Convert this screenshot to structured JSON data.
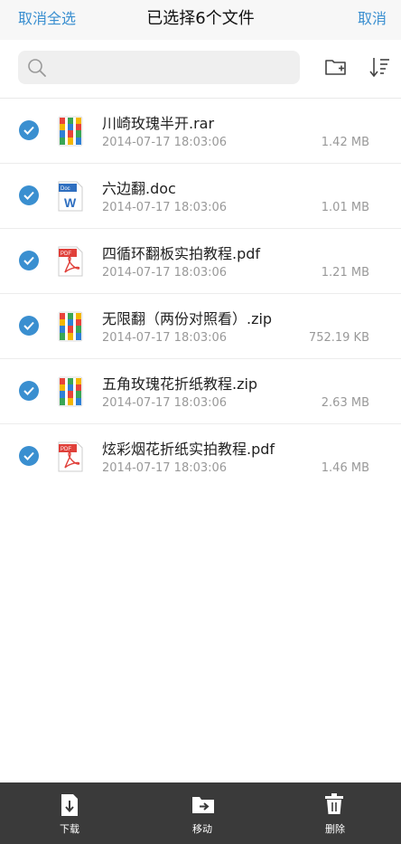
{
  "header": {
    "cancel_select_all": "取消全选",
    "title": "已选择6个文件",
    "cancel": "取消"
  },
  "toolbar": {
    "search_icon": "search-icon",
    "new_folder_icon": "new-folder-icon",
    "sort_icon": "sort-icon"
  },
  "files": [
    {
      "name": "川崎玫瑰半开.rar",
      "date": "2014-07-17 18:03:06",
      "size": "1.42 MB",
      "type": "archive",
      "selected": true
    },
    {
      "name": "六边翻.doc",
      "date": "2014-07-17 18:03:06",
      "size": "1.01 MB",
      "type": "doc",
      "selected": true
    },
    {
      "name": "四循环翻板实拍教程.pdf",
      "date": "2014-07-17 18:03:06",
      "size": "1.21 MB",
      "type": "pdf",
      "selected": true
    },
    {
      "name": "无限翻（两份对照看）.zip",
      "date": "2014-07-17 18:03:06",
      "size": "752.19 KB",
      "type": "archive",
      "selected": true
    },
    {
      "name": "五角玫瑰花折纸教程.zip",
      "date": "2014-07-17 18:03:06",
      "size": "2.63 MB",
      "type": "archive",
      "selected": true
    },
    {
      "name": "炫彩烟花折纸实拍教程.pdf",
      "date": "2014-07-17 18:03:06",
      "size": "1.46 MB",
      "type": "pdf",
      "selected": true
    }
  ],
  "icon_labels": {
    "doc_badge": "Doc",
    "doc_letter": "W",
    "pdf_badge": "PDF"
  },
  "bottom_bar": {
    "download": "下载",
    "move": "移动",
    "delete": "删除"
  },
  "colors": {
    "accent": "#3a8fd0",
    "bottom_bar": "#3a3a3a",
    "pdf_red": "#e0403a",
    "doc_blue": "#2f6fc0"
  }
}
